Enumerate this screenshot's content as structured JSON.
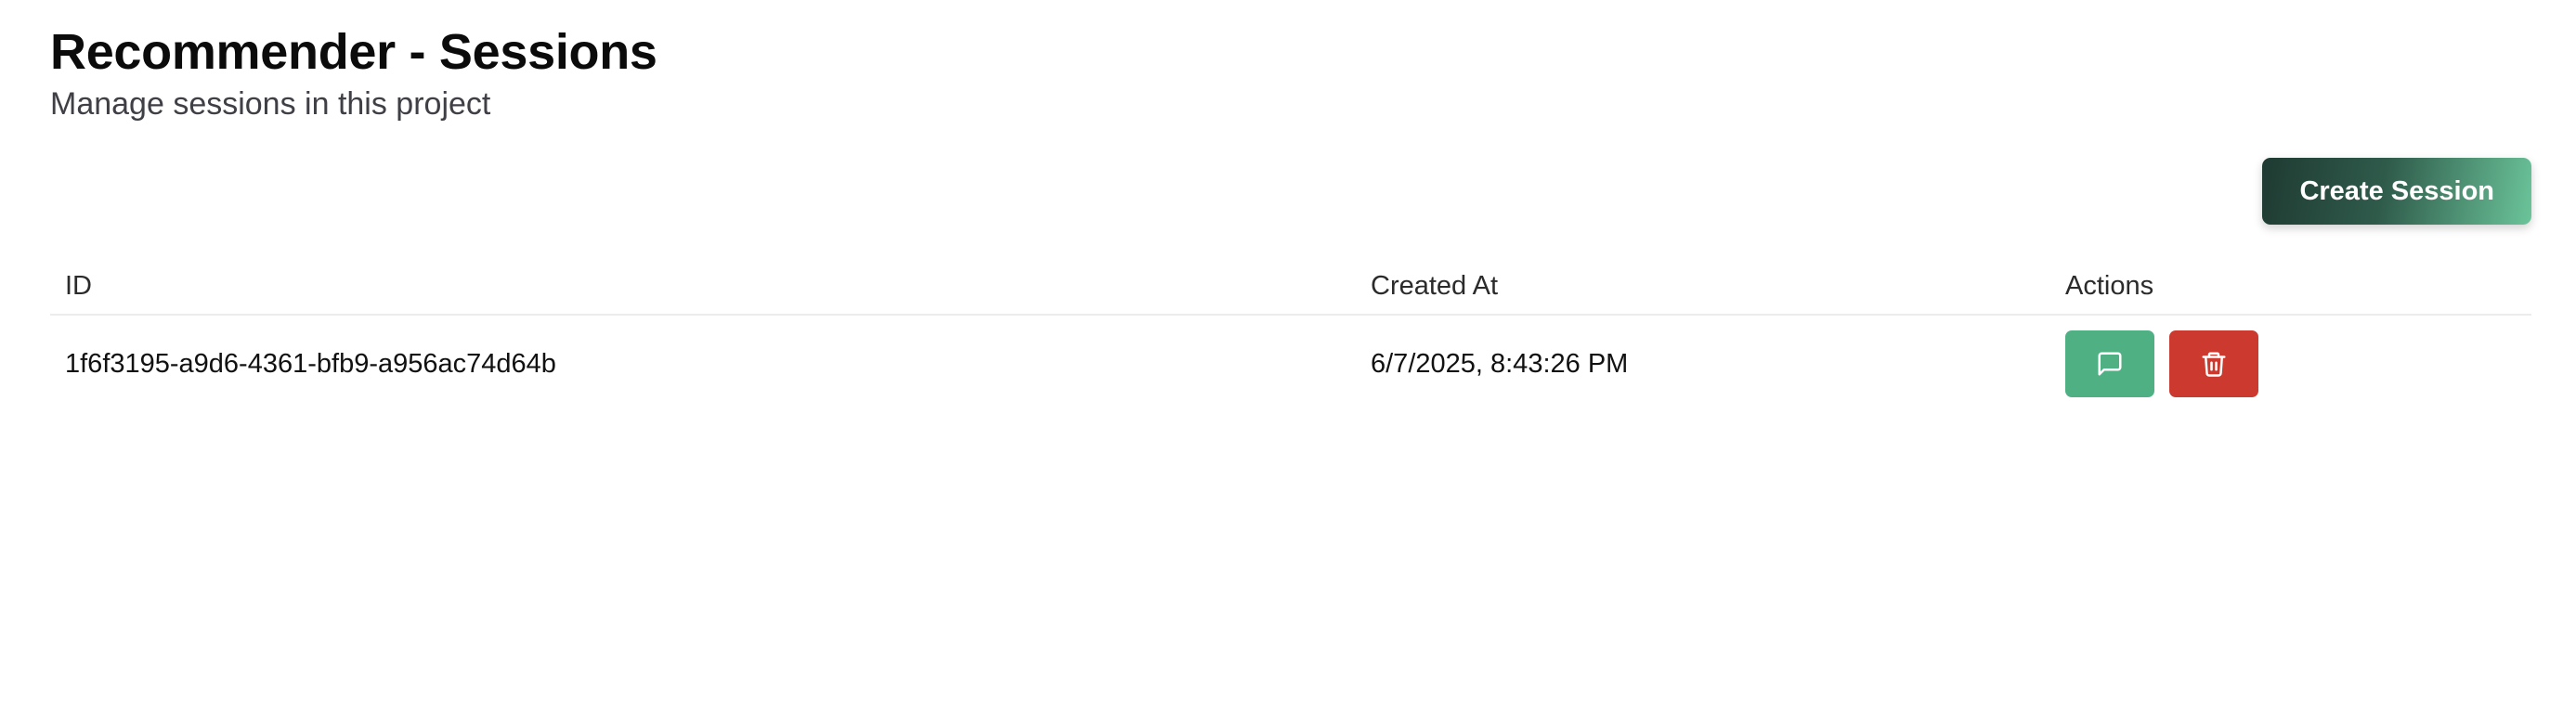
{
  "header": {
    "title": "Recommender - Sessions",
    "subtitle": "Manage sessions in this project"
  },
  "toolbar": {
    "create_label": "Create Session"
  },
  "table": {
    "columns": [
      "ID",
      "Created At",
      "Actions"
    ],
    "rows": [
      {
        "id": "1f6f3195-a9d6-4361-bfb9-a956ac74d64b",
        "created_at": "6/7/2025, 8:43:26 PM",
        "actions": [
          "message-square-icon",
          "trash-icon"
        ]
      }
    ]
  },
  "colors": {
    "chat_button": "#4fb083",
    "delete_button": "#cc3a2f",
    "create_button_start": "#1f3a32",
    "create_button_end": "#6bc49a"
  }
}
